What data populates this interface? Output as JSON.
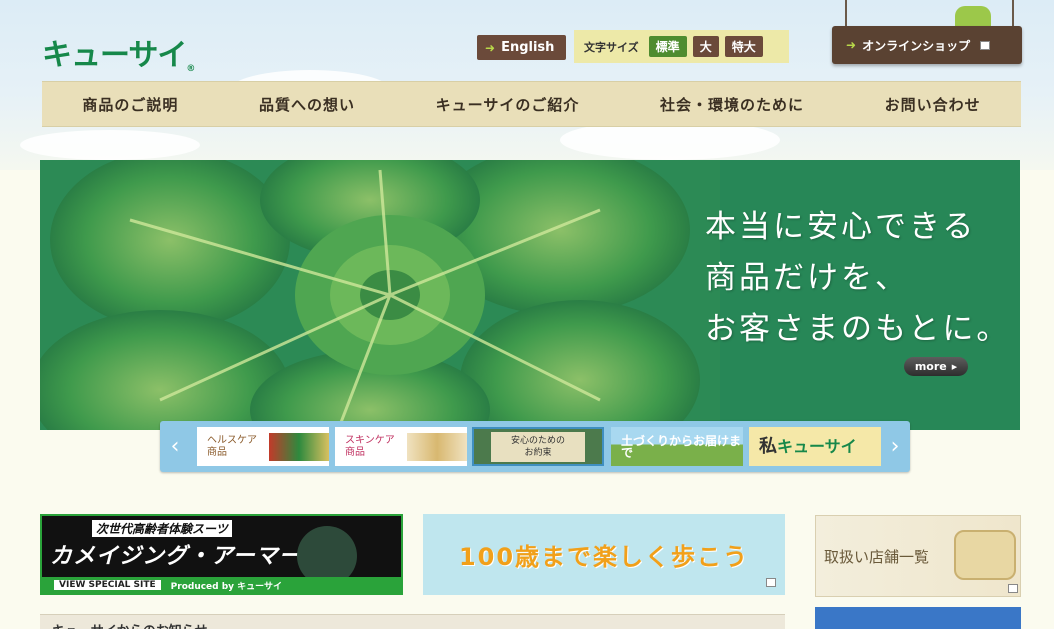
{
  "header": {
    "logo": "キューサイ",
    "logo_mark": "®",
    "english_label": "English",
    "font_size_label": "文字サイズ",
    "font_sizes": [
      "標準",
      "大",
      "特大"
    ],
    "online_shop_label": "オンラインショップ"
  },
  "nav": {
    "items": [
      "商品のご説明",
      "品質への想い",
      "キューサイのご紹介",
      "社会・環境のために",
      "お問い合わせ"
    ]
  },
  "hero": {
    "lines": [
      "本当に安心できる",
      "商品だけを、",
      "お客さまのもとに。"
    ],
    "more_label": "more"
  },
  "carousel": {
    "prev": "‹",
    "next": "›",
    "items": [
      {
        "line1": "ヘルスケア",
        "line2": "商品"
      },
      {
        "line1": "スキンケア",
        "line2": "商品"
      },
      {
        "line1": "安心のための",
        "line2": "お約束"
      },
      {
        "line1": "土づくりからお届けまで"
      },
      {
        "line1": "私",
        "line2": "キューサイ"
      }
    ]
  },
  "banners": {
    "aging_sub": "次世代高齢者体験スーツ",
    "aging_title": "カメイジング・アーマー",
    "aging_view": "VIEW SPECIAL SITE",
    "aging_produced": "Produced by キューサイ",
    "walk_text": "100歳まで楽しく歩こう",
    "store_text": "取扱い店舗一覧"
  },
  "news": {
    "title": "キューサイからのお知らせ"
  },
  "colors": {
    "brand_green": "#16884a",
    "hero_green": "#278757",
    "nav_bg": "#e9dfb9",
    "carousel_bg": "#8fc8e6"
  }
}
